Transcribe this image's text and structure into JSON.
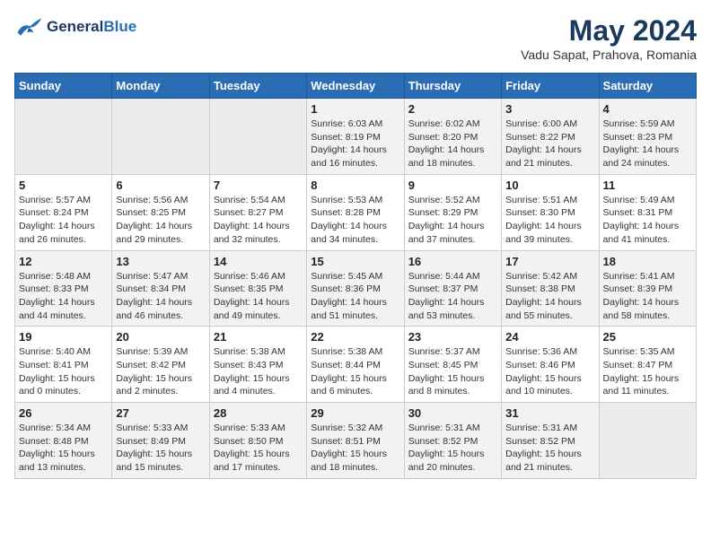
{
  "header": {
    "logo_line1": "General",
    "logo_line2": "Blue",
    "month": "May 2024",
    "location": "Vadu Sapat, Prahova, Romania"
  },
  "weekdays": [
    "Sunday",
    "Monday",
    "Tuesday",
    "Wednesday",
    "Thursday",
    "Friday",
    "Saturday"
  ],
  "weeks": [
    [
      {
        "day": "",
        "info": ""
      },
      {
        "day": "",
        "info": ""
      },
      {
        "day": "",
        "info": ""
      },
      {
        "day": "1",
        "info": "Sunrise: 6:03 AM\nSunset: 8:19 PM\nDaylight: 14 hours\nand 16 minutes."
      },
      {
        "day": "2",
        "info": "Sunrise: 6:02 AM\nSunset: 8:20 PM\nDaylight: 14 hours\nand 18 minutes."
      },
      {
        "day": "3",
        "info": "Sunrise: 6:00 AM\nSunset: 8:22 PM\nDaylight: 14 hours\nand 21 minutes."
      },
      {
        "day": "4",
        "info": "Sunrise: 5:59 AM\nSunset: 8:23 PM\nDaylight: 14 hours\nand 24 minutes."
      }
    ],
    [
      {
        "day": "5",
        "info": "Sunrise: 5:57 AM\nSunset: 8:24 PM\nDaylight: 14 hours\nand 26 minutes."
      },
      {
        "day": "6",
        "info": "Sunrise: 5:56 AM\nSunset: 8:25 PM\nDaylight: 14 hours\nand 29 minutes."
      },
      {
        "day": "7",
        "info": "Sunrise: 5:54 AM\nSunset: 8:27 PM\nDaylight: 14 hours\nand 32 minutes."
      },
      {
        "day": "8",
        "info": "Sunrise: 5:53 AM\nSunset: 8:28 PM\nDaylight: 14 hours\nand 34 minutes."
      },
      {
        "day": "9",
        "info": "Sunrise: 5:52 AM\nSunset: 8:29 PM\nDaylight: 14 hours\nand 37 minutes."
      },
      {
        "day": "10",
        "info": "Sunrise: 5:51 AM\nSunset: 8:30 PM\nDaylight: 14 hours\nand 39 minutes."
      },
      {
        "day": "11",
        "info": "Sunrise: 5:49 AM\nSunset: 8:31 PM\nDaylight: 14 hours\nand 41 minutes."
      }
    ],
    [
      {
        "day": "12",
        "info": "Sunrise: 5:48 AM\nSunset: 8:33 PM\nDaylight: 14 hours\nand 44 minutes."
      },
      {
        "day": "13",
        "info": "Sunrise: 5:47 AM\nSunset: 8:34 PM\nDaylight: 14 hours\nand 46 minutes."
      },
      {
        "day": "14",
        "info": "Sunrise: 5:46 AM\nSunset: 8:35 PM\nDaylight: 14 hours\nand 49 minutes."
      },
      {
        "day": "15",
        "info": "Sunrise: 5:45 AM\nSunset: 8:36 PM\nDaylight: 14 hours\nand 51 minutes."
      },
      {
        "day": "16",
        "info": "Sunrise: 5:44 AM\nSunset: 8:37 PM\nDaylight: 14 hours\nand 53 minutes."
      },
      {
        "day": "17",
        "info": "Sunrise: 5:42 AM\nSunset: 8:38 PM\nDaylight: 14 hours\nand 55 minutes."
      },
      {
        "day": "18",
        "info": "Sunrise: 5:41 AM\nSunset: 8:39 PM\nDaylight: 14 hours\nand 58 minutes."
      }
    ],
    [
      {
        "day": "19",
        "info": "Sunrise: 5:40 AM\nSunset: 8:41 PM\nDaylight: 15 hours\nand 0 minutes."
      },
      {
        "day": "20",
        "info": "Sunrise: 5:39 AM\nSunset: 8:42 PM\nDaylight: 15 hours\nand 2 minutes."
      },
      {
        "day": "21",
        "info": "Sunrise: 5:38 AM\nSunset: 8:43 PM\nDaylight: 15 hours\nand 4 minutes."
      },
      {
        "day": "22",
        "info": "Sunrise: 5:38 AM\nSunset: 8:44 PM\nDaylight: 15 hours\nand 6 minutes."
      },
      {
        "day": "23",
        "info": "Sunrise: 5:37 AM\nSunset: 8:45 PM\nDaylight: 15 hours\nand 8 minutes."
      },
      {
        "day": "24",
        "info": "Sunrise: 5:36 AM\nSunset: 8:46 PM\nDaylight: 15 hours\nand 10 minutes."
      },
      {
        "day": "25",
        "info": "Sunrise: 5:35 AM\nSunset: 8:47 PM\nDaylight: 15 hours\nand 11 minutes."
      }
    ],
    [
      {
        "day": "26",
        "info": "Sunrise: 5:34 AM\nSunset: 8:48 PM\nDaylight: 15 hours\nand 13 minutes."
      },
      {
        "day": "27",
        "info": "Sunrise: 5:33 AM\nSunset: 8:49 PM\nDaylight: 15 hours\nand 15 minutes."
      },
      {
        "day": "28",
        "info": "Sunrise: 5:33 AM\nSunset: 8:50 PM\nDaylight: 15 hours\nand 17 minutes."
      },
      {
        "day": "29",
        "info": "Sunrise: 5:32 AM\nSunset: 8:51 PM\nDaylight: 15 hours\nand 18 minutes."
      },
      {
        "day": "30",
        "info": "Sunrise: 5:31 AM\nSunset: 8:52 PM\nDaylight: 15 hours\nand 20 minutes."
      },
      {
        "day": "31",
        "info": "Sunrise: 5:31 AM\nSunset: 8:52 PM\nDaylight: 15 hours\nand 21 minutes."
      },
      {
        "day": "",
        "info": ""
      }
    ]
  ]
}
